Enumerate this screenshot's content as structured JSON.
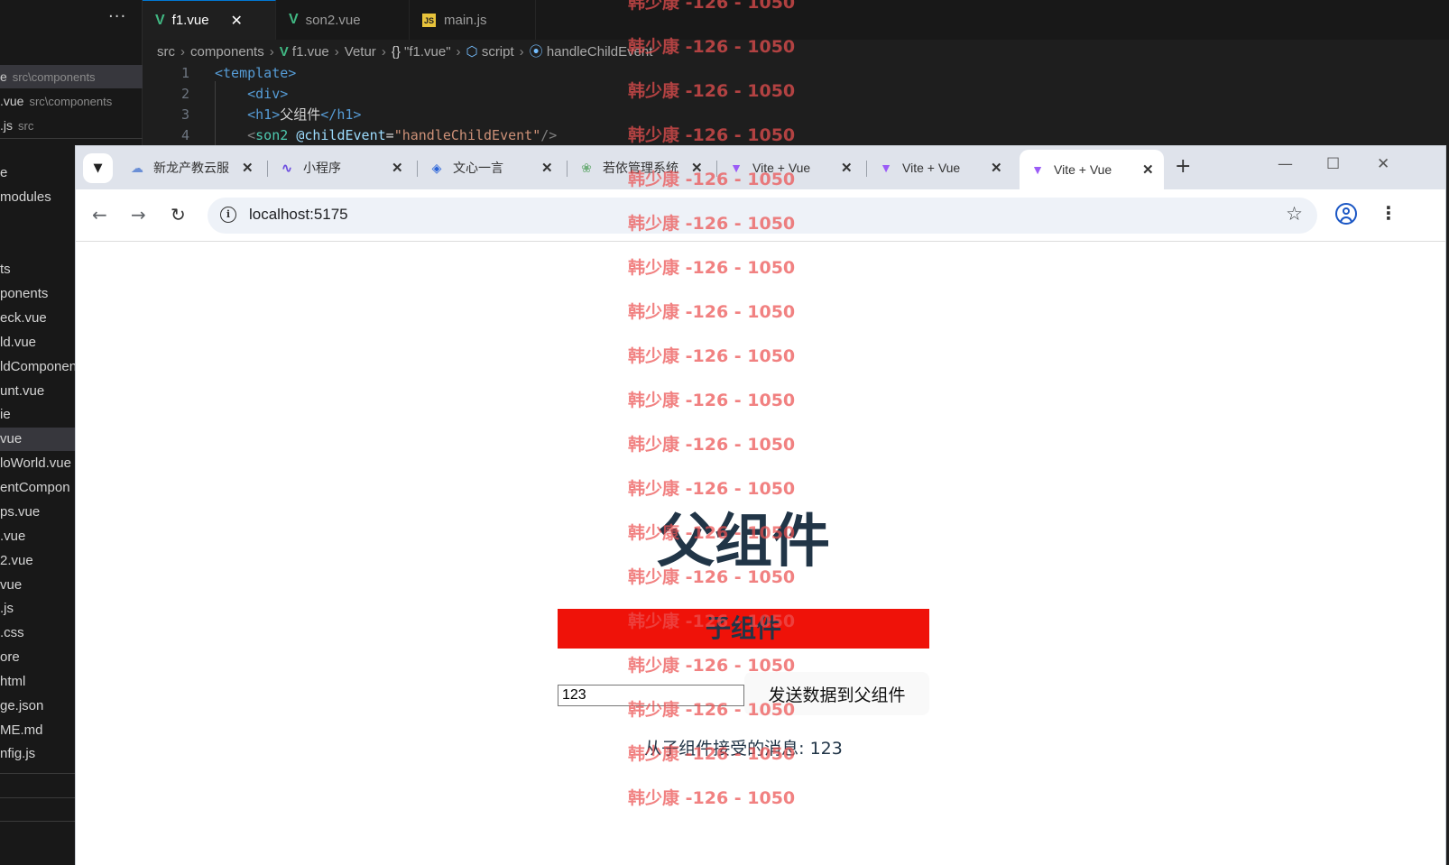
{
  "vscode": {
    "more_label": "···",
    "tabs": [
      {
        "label": "f1.vue",
        "close": "✕"
      },
      {
        "label": "son2.vue"
      },
      {
        "label": "main.js",
        "badge": "JS"
      }
    ],
    "breadcrumb": [
      "src",
      "components",
      "f1.vue",
      "Vetur",
      "\"f1.vue\"",
      "script",
      "handleChildEvent"
    ],
    "breadcrumb_icons": {
      "vue": "V",
      "curly": "{}",
      "cube": "⬡",
      "method": "⦿"
    },
    "open_editors": [
      {
        "name": "e",
        "dir": "src\\components"
      },
      {
        "name": ".vue",
        "dir": "src\\components"
      },
      {
        "name": ".js",
        "dir": "src"
      }
    ],
    "tree": [
      "e",
      "modules",
      "ts",
      "ponents",
      "eck.vue",
      "ld.vue",
      "ldComponent",
      "unt.vue",
      "ie",
      "vue",
      "loWorld.vue",
      "entCompon",
      "ps.vue",
      ".vue",
      "2.vue",
      "vue",
      ".js",
      ".css",
      "ore",
      "html",
      "ge.json",
      "ME.md",
      "nfig.js"
    ],
    "code": [
      {
        "num": "1",
        "tokens": [
          [
            "tag",
            "<template>"
          ]
        ]
      },
      {
        "num": "2",
        "tokens": [
          [
            "txt",
            "    "
          ],
          [
            "tag",
            "<div>"
          ]
        ]
      },
      {
        "num": "3",
        "tokens": [
          [
            "txt",
            "    "
          ],
          [
            "tag",
            "<h1>"
          ],
          [
            "txt",
            "父组件"
          ],
          [
            "tag",
            "</h1>"
          ]
        ]
      },
      {
        "num": "4",
        "tokens": [
          [
            "txt",
            "    "
          ],
          [
            "br",
            "<"
          ],
          [
            "comp",
            "son2"
          ],
          [
            "txt",
            " "
          ],
          [
            "attr",
            "@childEvent"
          ],
          [
            "txt",
            "="
          ],
          [
            "str",
            "\"handleChildEvent\""
          ],
          [
            "br",
            "/>"
          ]
        ]
      }
    ]
  },
  "chrome": {
    "tab_search_icon": "chevron-down-icon",
    "tabs": [
      {
        "label": "新龙产教云服",
        "icon": "☁"
      },
      {
        "label": "小程序",
        "icon": "∿"
      },
      {
        "label": "文心一言",
        "icon": "◈"
      },
      {
        "label": "若依管理系统",
        "icon": "❀"
      },
      {
        "label": "Vite + Vue",
        "icon": "▼"
      },
      {
        "label": "Vite + Vue",
        "icon": "▼"
      },
      {
        "label": "Vite + Vue",
        "icon": "▼"
      }
    ],
    "tab_close": "✕",
    "new_tab": "+",
    "window_controls": {
      "minimize": "—",
      "maximize": "☐",
      "close": "✕"
    },
    "nav": {
      "back": "←",
      "forward": "→",
      "reload": "↻"
    },
    "address": "localhost:5175",
    "info_glyph": "i",
    "bookmark_glyph": "☆",
    "menu_glyph": "⋮"
  },
  "page": {
    "parent_title": "父组件",
    "child_title": "子组件",
    "input_value": "123",
    "send_button": "发送数据到父组件",
    "received_message": "从子组件接受的消息: 123"
  },
  "watermark": {
    "text": "韩少康 -126 - 1050",
    "repeat": 19
  },
  "colors": {
    "vue_green": "#41b883",
    "child_bg": "#ef1209",
    "heading": "#213547",
    "watermark": "#ec5050"
  }
}
